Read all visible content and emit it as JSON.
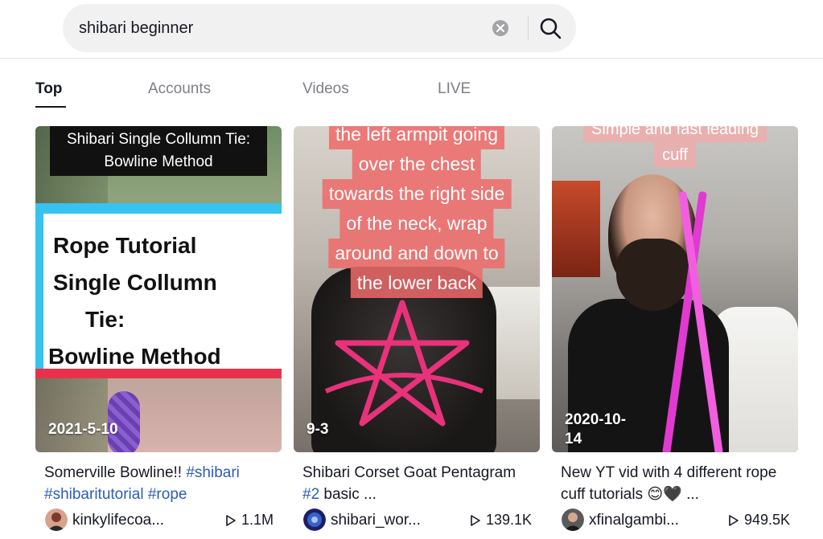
{
  "search": {
    "query": "shibari beginner",
    "clear_icon": "close-circle-icon",
    "search_icon": "magnifier-icon"
  },
  "tabs": [
    {
      "label": "Top",
      "active": true
    },
    {
      "label": "Accounts",
      "active": false
    },
    {
      "label": "Videos",
      "active": false
    },
    {
      "label": "LIVE",
      "active": false
    }
  ],
  "colors": {
    "text": "#161823",
    "muted": "#7d7f86",
    "hashtag": "#2b5db9",
    "search_bg": "#f1f1f2"
  },
  "cards": [
    {
      "overlay_caption": "Shibari Single Collumn Tie: Bowline Method",
      "overlay_title": [
        "Rope Tutorial",
        "Single Collumn",
        "Tie:",
        "Bowline Method"
      ],
      "date": "2021-5-10",
      "desc_text": "Somerville Bowline!! ",
      "desc_tags": [
        "#shibari",
        "#shibaritutorial",
        "#rope"
      ],
      "author": "kinkylifecoa...",
      "plays": "1.1M"
    },
    {
      "overlay_caption_lines": [
        "the left armpit going",
        "over the chest",
        "towards the right side",
        "of the neck, wrap",
        "around  and down to",
        "the lower back"
      ],
      "date": "9-3",
      "desc_text": "Shibari Corset Goat Pentagram ",
      "desc_tag": "#2",
      "desc_suffix": " basic ...",
      "author": "shibari_wor...",
      "plays": "139.1K"
    },
    {
      "overlay_caption_lines": [
        "Simple and fast leading",
        "cuff"
      ],
      "date_lines": [
        "2020-10-",
        "14"
      ],
      "desc_text": "New YT vid with 4 different rope cuff tutorials 😊🖤 ...",
      "author": "xfinalgambi...",
      "plays": "949.5K"
    }
  ]
}
